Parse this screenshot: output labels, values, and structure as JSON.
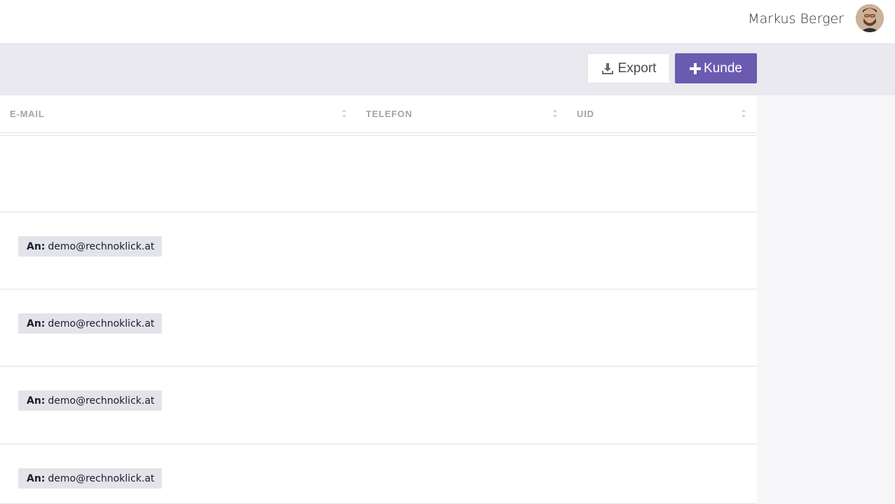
{
  "header": {
    "user_name": "Markus Berger",
    "avatar_icon": "user-avatar"
  },
  "toolbar": {
    "export_label": "Export",
    "export_icon": "download-icon",
    "add_customer_label": "Kunde",
    "add_customer_icon": "plus-icon",
    "accent_color": "#6b5bb0"
  },
  "table": {
    "columns": [
      "E-MAIL",
      "TELEFON",
      "UID"
    ],
    "rows": [
      {
        "email_prefix": "",
        "email": ""
      },
      {
        "email_prefix": "An:",
        "email": "demo@rechnoklick.at"
      },
      {
        "email_prefix": "An:",
        "email": "demo@rechnoklick.at"
      },
      {
        "email_prefix": "An:",
        "email": "demo@rechnoklick.at"
      },
      {
        "email_prefix": "An:",
        "email": "demo@rechnoklick.at"
      }
    ]
  }
}
